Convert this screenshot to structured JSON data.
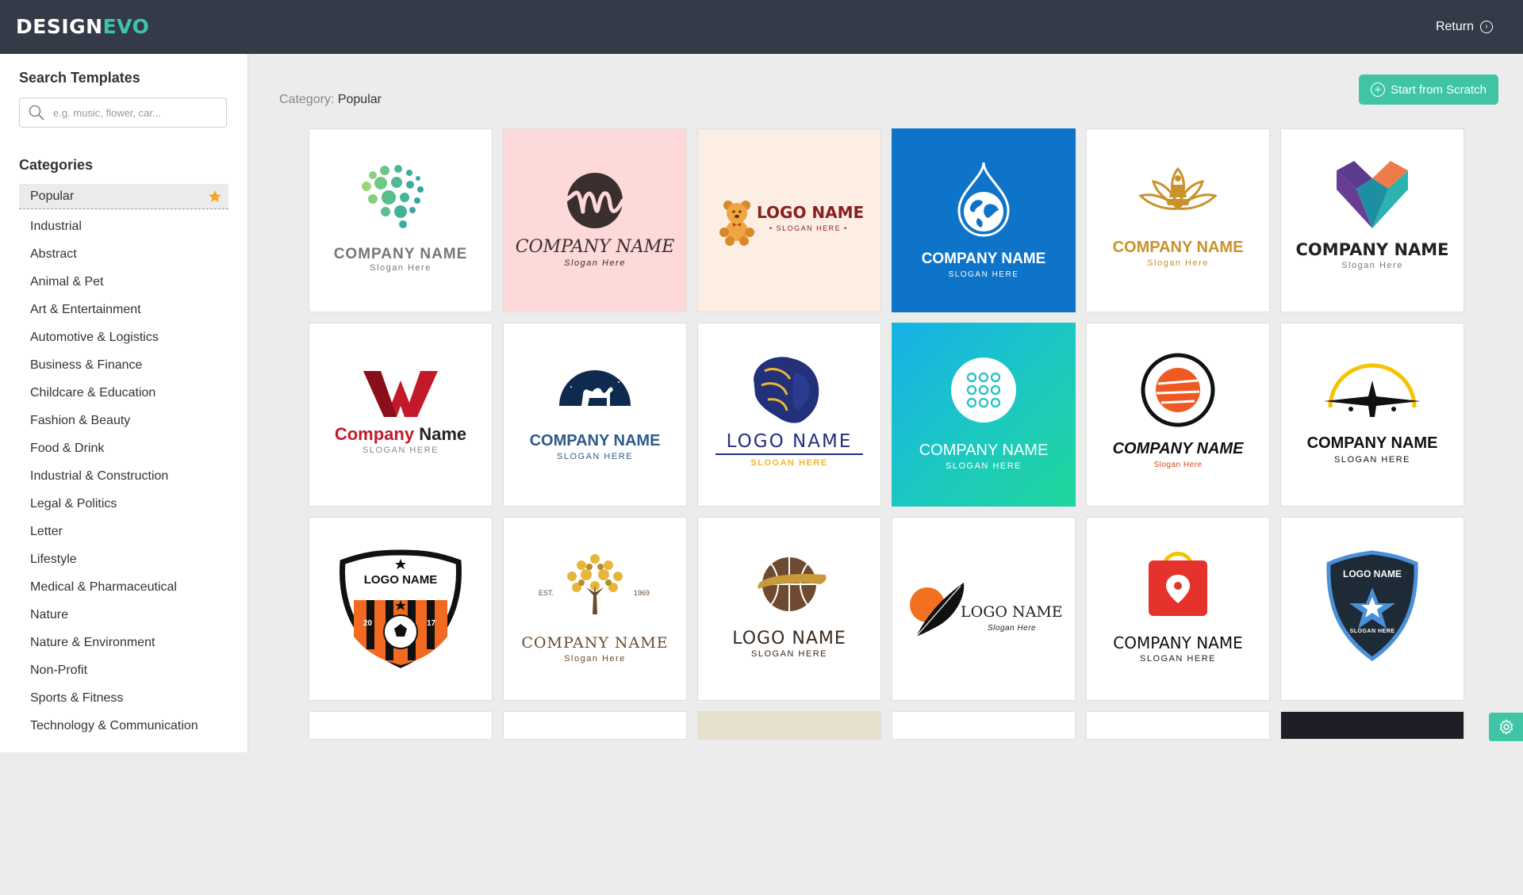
{
  "app": {
    "logo_part1": "DESIGN",
    "logo_part2": "EVO",
    "return_label": "Return"
  },
  "sidebar": {
    "search_title": "Search Templates",
    "search_placeholder": "e.g. music, flower, car...",
    "categories_title": "Categories",
    "active_category": "Popular",
    "categories": [
      "Industrial",
      "Abstract",
      "Animal & Pet",
      "Art & Entertainment",
      "Automotive & Logistics",
      "Business & Finance",
      "Childcare & Education",
      "Fashion & Beauty",
      "Food & Drink",
      "Industrial & Construction",
      "Legal & Politics",
      "Letter",
      "Lifestyle",
      "Medical & Pharmaceutical",
      "Nature",
      "Nature & Environment",
      "Non-Profit",
      "Sports & Fitness",
      "Technology & Communication"
    ]
  },
  "main": {
    "category_prefix": "Category:",
    "category_value": "Popular",
    "start_button": "Start from Scratch"
  },
  "templates": [
    {
      "name": "COMPANY NAME",
      "slogan": "Slogan Here"
    },
    {
      "name": "COMPANY NAME",
      "slogan": "Slogan Here"
    },
    {
      "name": "LOGO NAME",
      "slogan": "• SLOGAN HERE •"
    },
    {
      "name": "COMPANY NAME",
      "slogan": "SLOGAN HERE"
    },
    {
      "name": "COMPANY NAME",
      "slogan": "Slogan Here"
    },
    {
      "name": "COMPANY NAME",
      "slogan": "Slogan Here"
    },
    {
      "name": "Company",
      "name2": "Name",
      "slogan": "SLOGAN HERE"
    },
    {
      "name": "COMPANY NAME",
      "slogan": "SLOGAN HERE"
    },
    {
      "name": "LOGO NAME",
      "slogan": "SLOGAN HERE"
    },
    {
      "name": "COMPANY NAME",
      "slogan": "SLOGAN HERE"
    },
    {
      "name": "COMPANY NAME",
      "slogan": "Slogan Here"
    },
    {
      "name": "COMPANY NAME",
      "slogan": "SLOGAN HERE"
    },
    {
      "name": "LOGO NAME",
      "slogan": "",
      "year_left": "20",
      "year_right": "17"
    },
    {
      "name": "COMPANY NAME",
      "slogan": "Slogan Here",
      "est": "EST.",
      "year": "1969"
    },
    {
      "name": "LOGO NAME",
      "slogan": "SLOGAN HERE"
    },
    {
      "name": "LOGO NAME",
      "slogan": "Slogan Here"
    },
    {
      "name": "COMPANY NAME",
      "slogan": "SLOGAN HERE"
    },
    {
      "name": "LOGO NAME",
      "slogan": "SLOGAN HERE"
    }
  ],
  "colors": {
    "topbar": "#343a47",
    "accent": "#3fc5a5",
    "sidebar_active": "#ebebeb",
    "star": "#f5a623"
  }
}
